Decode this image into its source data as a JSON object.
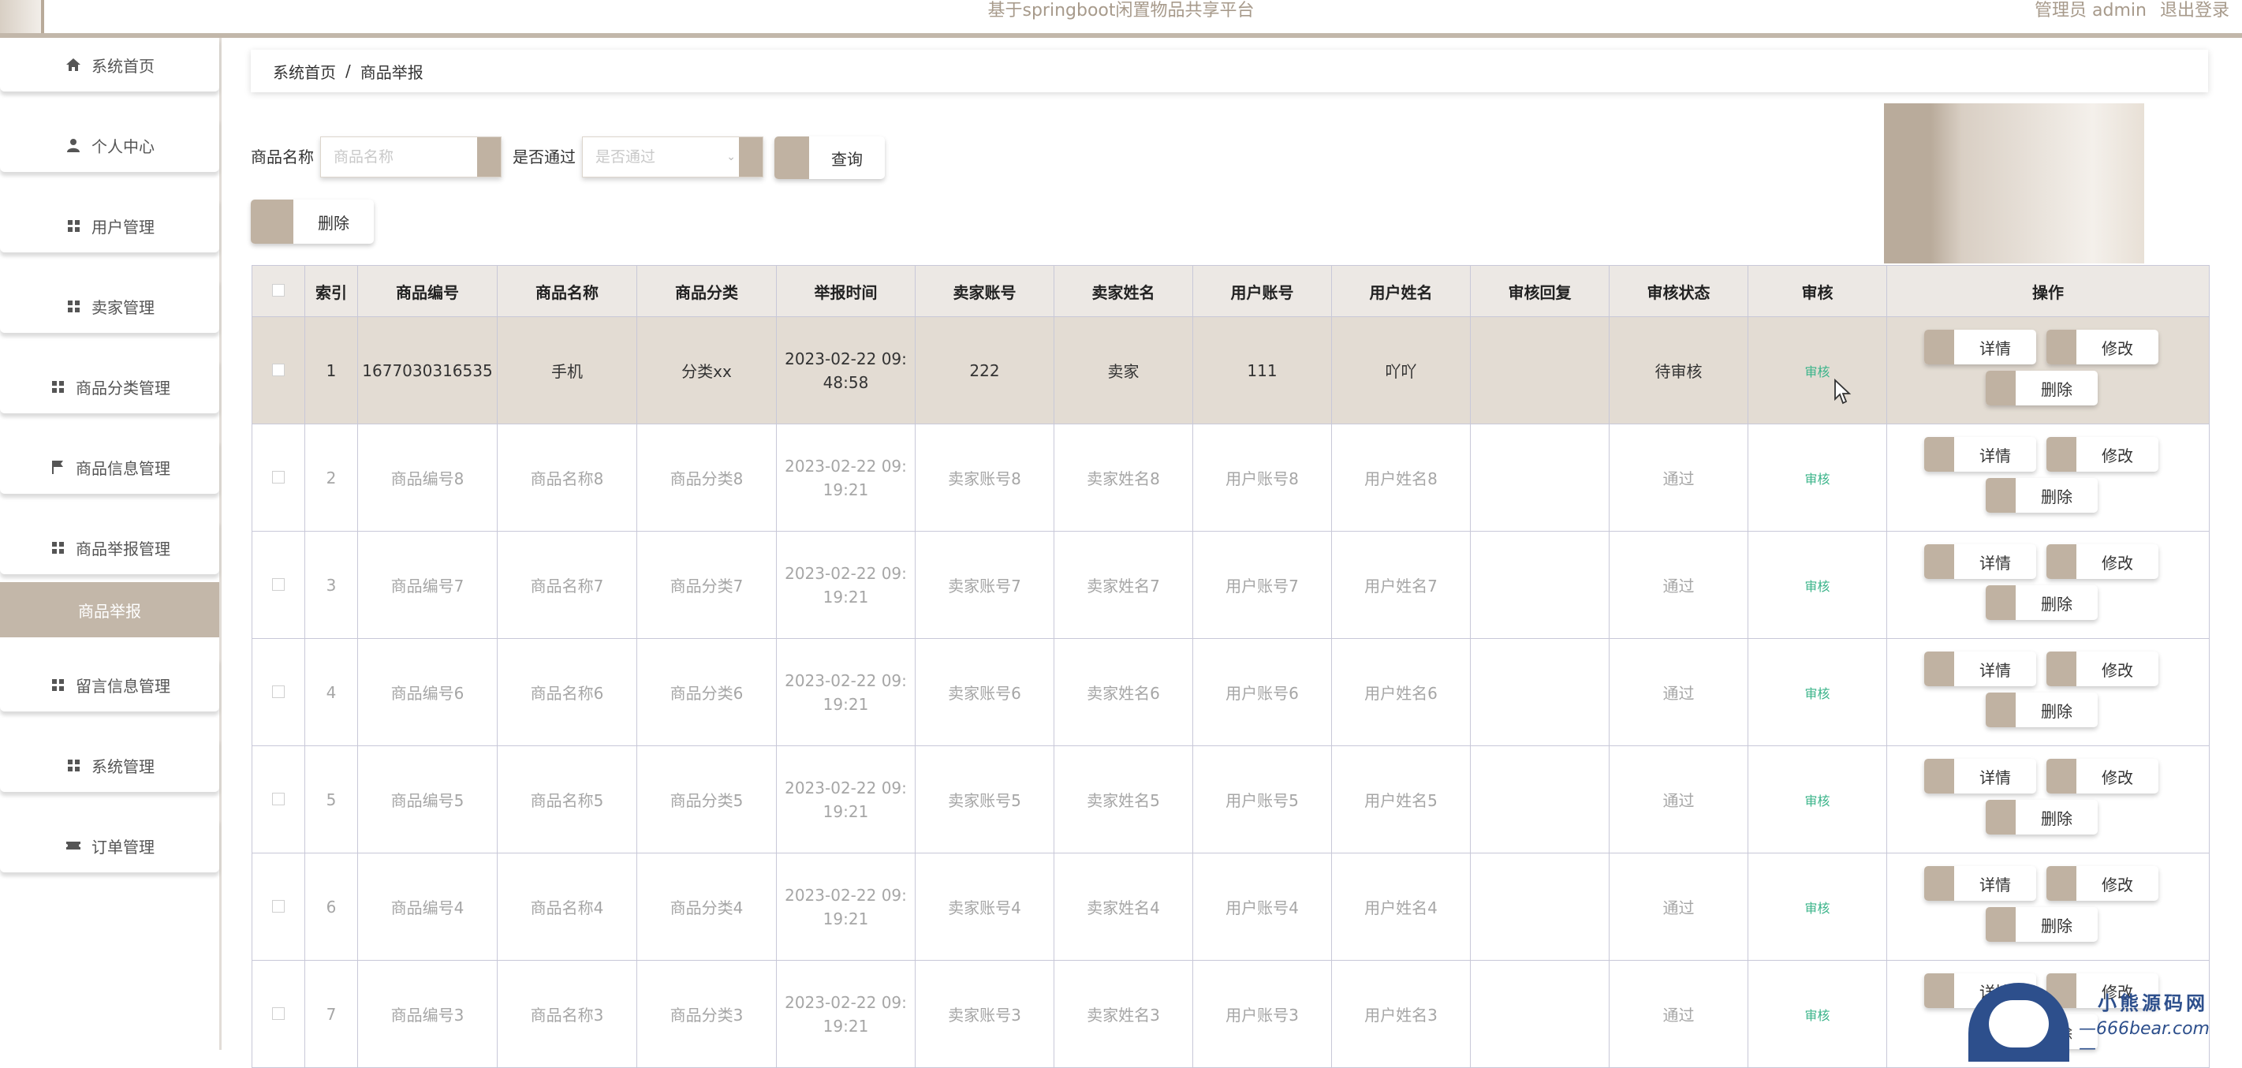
{
  "header": {
    "title": "基于springboot闲置物品共享平台",
    "user_role": "管理员 admin",
    "logout": "退出登录"
  },
  "sidebar": {
    "items": [
      {
        "label": "系统首页",
        "icon": "home-icon"
      },
      {
        "label": "个人中心",
        "icon": "user-icon"
      },
      {
        "label": "用户管理",
        "icon": "grid-icon"
      },
      {
        "label": "卖家管理",
        "icon": "grid-icon"
      },
      {
        "label": "商品分类管理",
        "icon": "grid-icon"
      },
      {
        "label": "商品信息管理",
        "icon": "flag-icon"
      },
      {
        "label": "商品举报管理",
        "icon": "grid-icon"
      },
      {
        "label": "商品举报",
        "icon": "",
        "active": true
      },
      {
        "label": "留言信息管理",
        "icon": "grid-icon"
      },
      {
        "label": "系统管理",
        "icon": "grid-icon"
      },
      {
        "label": "订单管理",
        "icon": "ticket-icon"
      }
    ]
  },
  "breadcrumb": {
    "home": "系统首页",
    "separator": "/",
    "current": "商品举报"
  },
  "search": {
    "name_label": "商品名称",
    "name_placeholder": "商品名称",
    "passed_label": "是否通过",
    "passed_placeholder": "是否通过",
    "query_button": "查询",
    "delete_button": "删除"
  },
  "table": {
    "headers": [
      "索引",
      "商品编号",
      "商品名称",
      "商品分类",
      "举报时间",
      "卖家账号",
      "卖家姓名",
      "用户账号",
      "用户姓名",
      "审核回复",
      "审核状态",
      "审核",
      "操作"
    ],
    "audit_link": "审核",
    "actions": {
      "detail": "详情",
      "edit": "修改",
      "delete": "删除"
    },
    "rows": [
      {
        "index": "1",
        "code": "1677030316535",
        "name": "手机",
        "category": "分类xx",
        "time1": "2023-02-22 09:",
        "time2": "48:58",
        "seller_acc": "222",
        "seller_name": "卖家",
        "user_acc": "111",
        "user_name": "吖吖",
        "reply": "",
        "status": "待审核"
      },
      {
        "index": "2",
        "code": "商品编号8",
        "name": "商品名称8",
        "category": "商品分类8",
        "time1": "2023-02-22 09:",
        "time2": "19:21",
        "seller_acc": "卖家账号8",
        "seller_name": "卖家姓名8",
        "user_acc": "用户账号8",
        "user_name": "用户姓名8",
        "reply": "",
        "status": "通过"
      },
      {
        "index": "3",
        "code": "商品编号7",
        "name": "商品名称7",
        "category": "商品分类7",
        "time1": "2023-02-22 09:",
        "time2": "19:21",
        "seller_acc": "卖家账号7",
        "seller_name": "卖家姓名7",
        "user_acc": "用户账号7",
        "user_name": "用户姓名7",
        "reply": "",
        "status": "通过"
      },
      {
        "index": "4",
        "code": "商品编号6",
        "name": "商品名称6",
        "category": "商品分类6",
        "time1": "2023-02-22 09:",
        "time2": "19:21",
        "seller_acc": "卖家账号6",
        "seller_name": "卖家姓名6",
        "user_acc": "用户账号6",
        "user_name": "用户姓名6",
        "reply": "",
        "status": "通过"
      },
      {
        "index": "5",
        "code": "商品编号5",
        "name": "商品名称5",
        "category": "商品分类5",
        "time1": "2023-02-22 09:",
        "time2": "19:21",
        "seller_acc": "卖家账号5",
        "seller_name": "卖家姓名5",
        "user_acc": "用户账号5",
        "user_name": "用户姓名5",
        "reply": "",
        "status": "通过"
      },
      {
        "index": "6",
        "code": "商品编号4",
        "name": "商品名称4",
        "category": "商品分类4",
        "time1": "2023-02-22 09:",
        "time2": "19:21",
        "seller_acc": "卖家账号4",
        "seller_name": "卖家姓名4",
        "user_acc": "用户账号4",
        "user_name": "用户姓名4",
        "reply": "",
        "status": "通过"
      },
      {
        "index": "7",
        "code": "商品编号3",
        "name": "商品名称3",
        "category": "商品分类3",
        "time1": "2023-02-22 09:",
        "time2": "19:21",
        "seller_acc": "卖家账号3",
        "seller_name": "卖家姓名3",
        "user_acc": "用户账号3",
        "user_name": "用户姓名3",
        "reply": "",
        "status": "通过"
      }
    ]
  },
  "watermark": {
    "name": "小熊源码网",
    "url": "—666bear.com—"
  },
  "colors": {
    "accent": "#c0b2a2",
    "highlight_row": "#e3dcd3",
    "audit_link": "#3bb48a",
    "brand_blue": "#2d4f8c"
  }
}
